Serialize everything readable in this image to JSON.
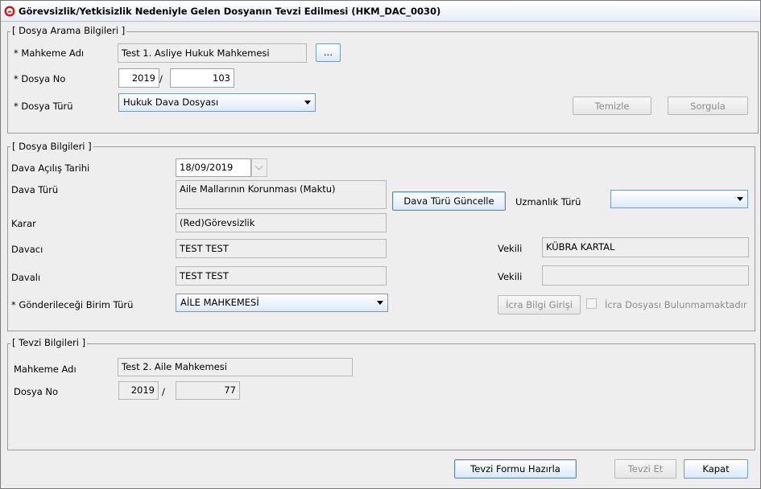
{
  "window": {
    "title": "Görevsizlik/Yetkisizlik Nedeniyle Gelen Dosyanın Tevzi Edilmesi (HKM_DAC_0030)"
  },
  "search_section": {
    "legend": "[ Dosya Arama Bilgileri ]",
    "court_label": "* Mahkeme Adı",
    "court_value": "Test 1. Asliye Hukuk Mahkemesi",
    "browse_label": "...",
    "file_no_label": "* Dosya No",
    "file_year": "2019",
    "file_sep": "/",
    "file_number": "103",
    "file_type_label": "* Dosya Türü",
    "file_type_value": "Hukuk Dava Dosyası",
    "clear_label": "Temizle",
    "query_label": "Sorgula"
  },
  "file_section": {
    "legend": "[ Dosya Bilgileri ]",
    "open_date_label": "Dava Açılış Tarihi",
    "open_date_value": "18/09/2019",
    "case_type_label": "Dava Türü",
    "case_type_value": "Aile Mallarının Korunması (Maktu)",
    "update_case_type_label": "Dava Türü Güncelle",
    "expertise_label": "Uzmanlık Türü",
    "expertise_value": "",
    "decision_label": "Karar",
    "decision_value": "(Red)Görevsizlik",
    "plaintiff_label": "Davacı",
    "plaintiff_value": "TEST TEST",
    "plaintiff_attorney_label": "Vekili",
    "plaintiff_attorney_value": "KÜBRA KARTAL",
    "defendant_label": "Davalı",
    "defendant_value": "TEST TEST",
    "defendant_attorney_label": "Vekili",
    "defendant_attorney_value": "",
    "target_unit_label": "* Gönderileceği Birim Türü",
    "target_unit_value": "AİLE MAHKEMESİ",
    "enforcement_button_label": "İcra Bilgi Girişi",
    "no_enforcement_label": "İcra Dosyası Bulunmamaktadır"
  },
  "distribution_section": {
    "legend": "[ Tevzi Bilgileri ]",
    "court_label": "Mahkeme Adı",
    "court_value": "Test 2. Aile Mahkemesi",
    "file_no_label": "Dosya No",
    "file_year": "2019",
    "file_sep": "/",
    "file_number": "77"
  },
  "footer": {
    "prepare_form_label": "Tevzi Formu Hazırla",
    "distribute_label": "Tevzi Et",
    "close_label": "Kapat"
  },
  "colors": {
    "window_bg": "#eeeeee",
    "button_gradient_bottom": "#dbe8f6",
    "button_border": "#7c99b8",
    "app_icon": "#c81e1e"
  },
  "icons": {
    "app": "turkish-judiciary-emblem-icon",
    "combo_arrow": "triangle-down-icon",
    "date_picker": "chevron-down-icon"
  }
}
